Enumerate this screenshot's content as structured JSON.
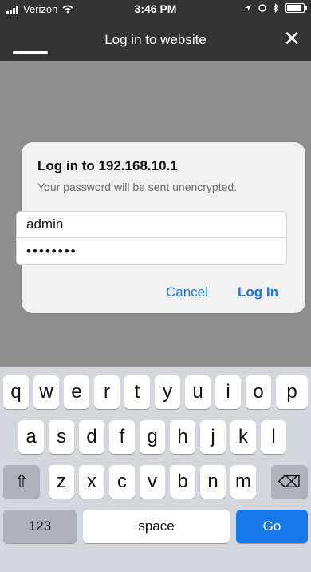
{
  "status_bar": {
    "carrier": "Verizon",
    "time": "3:46 PM"
  },
  "navbar": {
    "title": "Log in to website",
    "close_glyph": "✕"
  },
  "dialog": {
    "title": "Log in to 192.168.10.1",
    "subtitle": "Your password will be sent unencrypted.",
    "username_value": "admin",
    "password_value": "••••••••",
    "cancel_label": "Cancel",
    "login_label": "Log In"
  },
  "keyboard": {
    "row1": [
      "q",
      "w",
      "e",
      "r",
      "t",
      "y",
      "u",
      "i",
      "o",
      "p"
    ],
    "row2": [
      "a",
      "s",
      "d",
      "f",
      "g",
      "h",
      "j",
      "k",
      "l"
    ],
    "row3": [
      "z",
      "x",
      "c",
      "v",
      "b",
      "n",
      "m"
    ],
    "shift_glyph": "⇧",
    "delete_glyph": "⌫",
    "numbers_label": "123",
    "space_label": "space",
    "go_label": "Go"
  },
  "colors": {
    "accent": "#1678e8",
    "bar": "#333333",
    "dim_background": "#8e8e8e"
  },
  "icons": [
    "signal-icon",
    "wifi-icon",
    "location-icon",
    "alarm-icon",
    "bluetooth-icon",
    "battery-icon",
    "close-icon",
    "shift-icon",
    "delete-icon"
  ]
}
